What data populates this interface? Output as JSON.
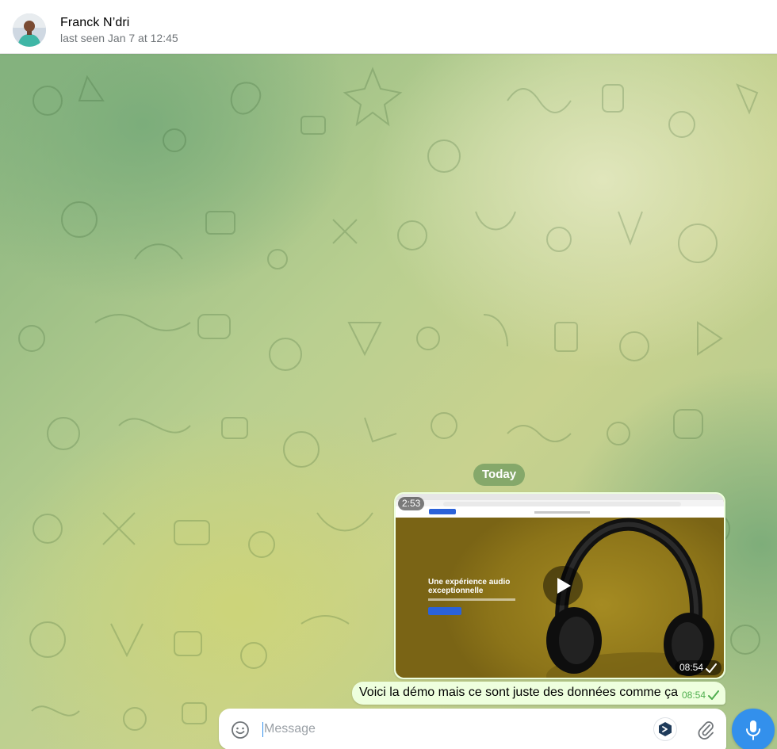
{
  "header": {
    "contact_name": "Franck N’dri",
    "status": "last seen Jan 7 at 12:45"
  },
  "chat": {
    "date_separator": "Today",
    "video_message": {
      "duration": "2:53",
      "time": "08:54",
      "preview": {
        "hero_title": "Une expérience audio\nexceptionnelle"
      }
    },
    "text_message": {
      "text": "Voici la démo mais ce sont juste des données comme ça",
      "time": "08:54"
    }
  },
  "composer": {
    "placeholder": "Message"
  },
  "colors": {
    "accent": "#3390ec",
    "outgoing_bubble": "#eeffde",
    "read_check": "#4fae4e"
  }
}
